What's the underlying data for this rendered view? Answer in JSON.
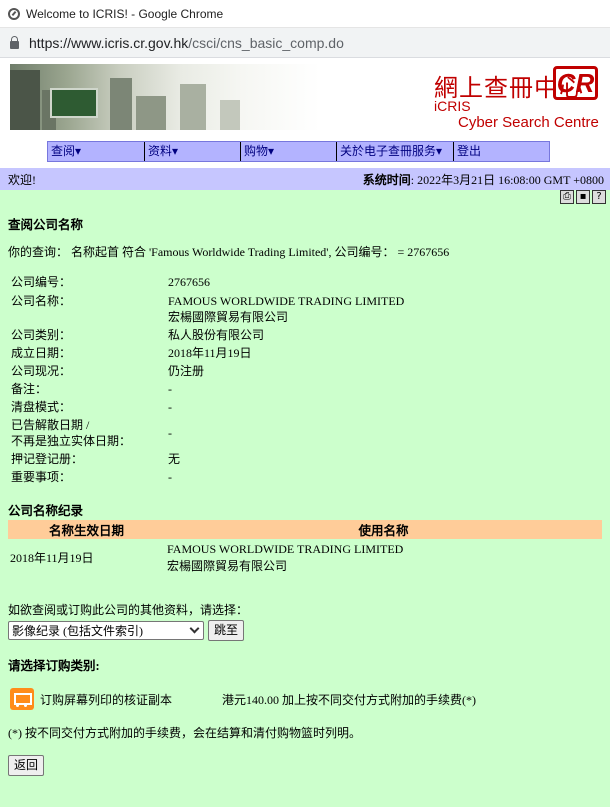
{
  "browser": {
    "window_title": "Welcome to ICRIS! - Google Chrome",
    "url_host": "https://www.icris.cr.gov.hk",
    "url_path": "/csci/cns_basic_comp.do"
  },
  "banner": {
    "logo_zh": "網上查冊中心",
    "logo_box": "CR",
    "logo_en1": "iCRIS",
    "logo_en2": "Cyber Search Centre"
  },
  "menu": {
    "items": [
      {
        "label": "查阅▾"
      },
      {
        "label": "资料▾"
      },
      {
        "label": "购物▾"
      },
      {
        "label": "关於电子查冊服务▾"
      },
      {
        "label": "登出"
      }
    ]
  },
  "welcome": {
    "text": "欢迎!",
    "time_label": "系统时间",
    "time_value": ": 2022年3月21日 16:08:00 GMT +0800"
  },
  "tools": [
    "print-icon",
    "save-icon",
    "help-icon"
  ],
  "search": {
    "heading": "查阅公司名称",
    "query_text": "你的查询： 名称起首 符合 'Famous Worldwide Trading Limited', 公司编号： = 2767656"
  },
  "company": {
    "fields": [
      {
        "label": "公司编号：",
        "value": "2767656"
      },
      {
        "label": "公司名称：",
        "value": "FAMOUS WORLDWIDE TRADING LIMITED",
        "value2": "宏楊國際貿易有限公司"
      },
      {
        "label": "公司类别：",
        "value": "私人股份有限公司"
      },
      {
        "label": "成立日期：",
        "value": "2018年11月19日"
      },
      {
        "label": "公司现况：",
        "value": "仍注册"
      },
      {
        "label": "备注：",
        "value": "-"
      },
      {
        "label": "清盘模式：",
        "value": "-"
      },
      {
        "label": "已告解散日期 /",
        "label2": "不再是独立实体日期：",
        "value": "-"
      },
      {
        "label": "押记登记册：",
        "value": "无"
      },
      {
        "label": "重要事项：",
        "value": "-"
      }
    ]
  },
  "names_record": {
    "title": "公司名称纪录",
    "headers": [
      "名称生效日期",
      "使用名称"
    ],
    "rows": [
      {
        "date": "2018年11月19日",
        "name_en": "FAMOUS WORLDWIDE TRADING LIMITED",
        "name_zh": "宏楊國際貿易有限公司"
      }
    ]
  },
  "more_info": {
    "prompt": "如欲查阅或订购此公司的其他资料，请选择：",
    "select_value": "影像纪录 (包括文件索引)",
    "go_button": "跳至"
  },
  "order": {
    "title": "请选择订购类别:",
    "item_label": "订购屏幕列印的核证副本",
    "item_price": "港元140.00 加上按不同交付方式附加的手续费(*)",
    "note": "(*) 按不同交付方式附加的手续费，会在结算和清付购物篮时列明。",
    "back_button": "返回"
  },
  "colors": {
    "page_bg": "#ccffcc",
    "menu_bg": "#b3b3ff",
    "welcome_bg": "#c6c6ff",
    "table_header_bg": "#ffcc99",
    "brand_red": "#c00000"
  }
}
